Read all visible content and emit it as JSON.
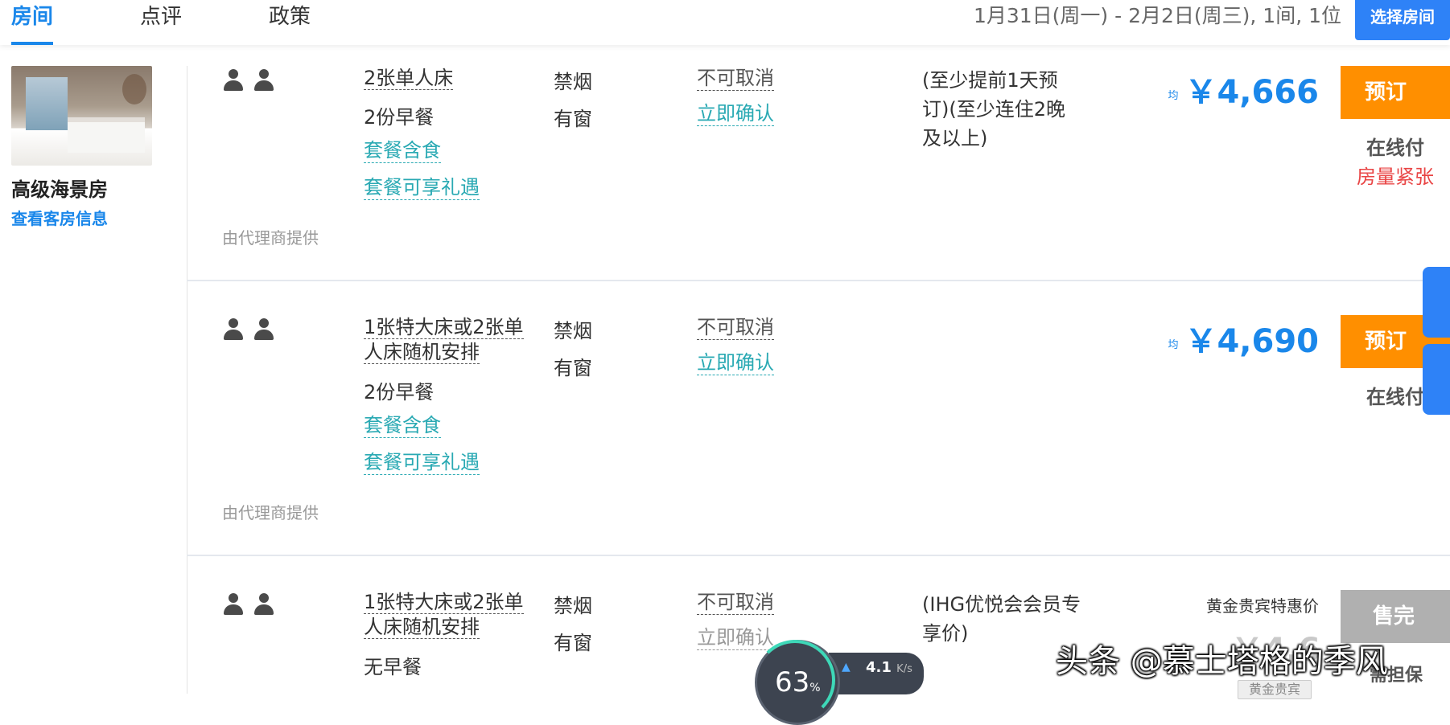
{
  "nav": {
    "tabs": [
      {
        "label": "房间"
      },
      {
        "label": "点评"
      },
      {
        "label": "政策"
      }
    ],
    "dates": "1月31日(周一) - 2月2日(周三), 1间, 1位",
    "select_room": "选择房间"
  },
  "room": {
    "title": "高级海景房",
    "info_link": "查看客房信息"
  },
  "rows": [
    {
      "bed": "2张单人床",
      "meal": "2份早餐",
      "pkg1": "套餐含食",
      "pkg2": "套餐可享礼遇",
      "agent": "由代理商提供",
      "smoke": "禁烟",
      "window": "有窗",
      "cancel": "不可取消",
      "confirm": "立即确认",
      "policy": "(至少提前1天预订)(至少连住2晚及以上)",
      "avg": "均",
      "price": "￥4,666",
      "book": "预订",
      "pay": "在线付",
      "scarce": "房量紧张"
    },
    {
      "bed": "1张特大床或2张单人床随机安排",
      "meal": "2份早餐",
      "pkg1": "套餐含食",
      "pkg2": "套餐可享礼遇",
      "agent": "由代理商提供",
      "smoke": "禁烟",
      "window": "有窗",
      "cancel": "不可取消",
      "confirm": "立即确认",
      "avg": "均",
      "price": "￥4,690",
      "book": "预订",
      "pay": "在线付"
    },
    {
      "bed": "1张特大床或2张单人床随机安排",
      "meal": "无早餐",
      "smoke": "禁烟",
      "window": "有窗",
      "cancel": "不可取消",
      "confirm": "立即确认",
      "policy": "(IHG优悦会会员专享价)",
      "gold_label": "黄金贵宾特惠价",
      "price_partial": "￥4,6",
      "soldout": "售完",
      "gold_badge": "黄金贵宾",
      "pay_partial": "需担保"
    }
  ],
  "net_widget": {
    "percent": "63",
    "percent_sign": "%",
    "speed": "4.1",
    "unit": "K/s"
  },
  "watermark": "头条 @慕士塔格的季风",
  "colors": {
    "accent": "#1a87ea",
    "teal_link": "#29a9b3",
    "book_orange": "#ff8f00",
    "scarce_red": "#e94545",
    "soldout_grey": "#b0b0b0"
  }
}
